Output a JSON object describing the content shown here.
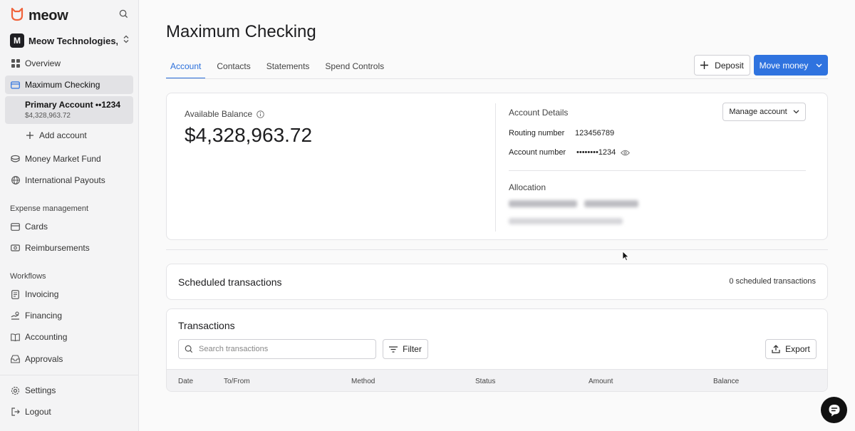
{
  "app": {
    "name": "meow",
    "org_initial": "M",
    "org_name": "Meow Technologies, I..."
  },
  "sidebar": {
    "items": [
      {
        "label": "Overview",
        "icon": "grid-icon"
      },
      {
        "label": "Maximum Checking",
        "icon": "wallet-icon",
        "active": true
      }
    ],
    "sub_account": {
      "title": "Primary Account ••1234",
      "balance": "$4,328,963.72"
    },
    "add_account": "Add account",
    "items2": [
      {
        "label": "Money Market Fund",
        "icon": "fund-icon"
      },
      {
        "label": "International Payouts",
        "icon": "globe-icon"
      }
    ],
    "expense_section": "Expense management",
    "expense_items": [
      {
        "label": "Cards",
        "icon": "card-icon"
      },
      {
        "label": "Reimbursements",
        "icon": "receipt-icon"
      }
    ],
    "workflows_section": "Workflows",
    "workflow_items": [
      {
        "label": "Invoicing",
        "icon": "invoice-icon"
      },
      {
        "label": "Financing",
        "icon": "financing-icon"
      },
      {
        "label": "Accounting",
        "icon": "book-icon"
      },
      {
        "label": "Approvals",
        "icon": "inbox-icon"
      }
    ],
    "footer_items": [
      {
        "label": "Settings",
        "icon": "gear-icon"
      },
      {
        "label": "Logout",
        "icon": "logout-icon"
      }
    ]
  },
  "main": {
    "title": "Maximum Checking",
    "tabs": [
      {
        "label": "Account",
        "active": true
      },
      {
        "label": "Contacts"
      },
      {
        "label": "Statements"
      },
      {
        "label": "Spend Controls"
      }
    ],
    "deposit_label": "Deposit",
    "move_money_label": "Move money",
    "balance": {
      "label": "Available Balance",
      "value": "$4,328,963.72"
    },
    "account_details": {
      "title": "Account Details",
      "manage_label": "Manage account",
      "routing_label": "Routing number",
      "routing_value": "123456789",
      "account_label": "Account number",
      "account_value": "••••••••1234"
    },
    "allocation_title": "Allocation",
    "scheduled": {
      "title": "Scheduled transactions",
      "count": "0 scheduled transactions"
    },
    "transactions": {
      "title": "Transactions",
      "search_placeholder": "Search transactions",
      "filter_label": "Filter",
      "export_label": "Export",
      "columns": [
        "Date",
        "To/From",
        "Method",
        "Status",
        "Amount",
        "Balance"
      ]
    }
  },
  "colors": {
    "accent": "#2f73df",
    "brand": "#f0623a"
  }
}
